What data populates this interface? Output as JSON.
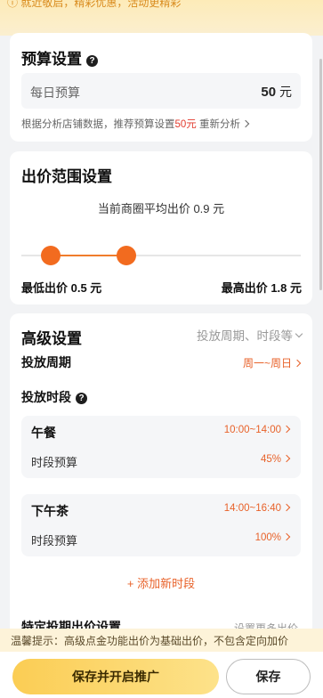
{
  "top_notice": "ⓘ 就近敬启，精彩优惠，活动更精彩",
  "budget": {
    "title": "预算设置",
    "daily_label": "每日预算",
    "daily_value": "50",
    "daily_unit": "元",
    "tip_prefix": "根据分析店铺数据，推荐预算设置",
    "tip_amount": "50元",
    "tip_link": "重新分析"
  },
  "bid": {
    "title": "出价范围设置",
    "avg_text": "当前商圈平均出价 0.9 元",
    "min_label": "最低出价 0.5 元",
    "max_label": "最高出价 1.8 元",
    "min_value": 0.5,
    "max_value": 1.8
  },
  "advanced": {
    "title": "高级设置",
    "hint": "投放周期、时段等",
    "period_label": "投放周期",
    "period_value": "周一~周日",
    "slot_section_label": "投放时段",
    "slots": [
      {
        "name": "午餐",
        "time": "10:00~14:00",
        "budget_label": "时段预算",
        "budget_pct": "45%"
      },
      {
        "name": "下午茶",
        "time": "14:00~16:40",
        "budget_label": "时段预算",
        "budget_pct": "100%"
      }
    ],
    "add_slot": "+ 添加新时段",
    "cut_row_label": "特定投期出价设置",
    "cut_row_value": "设置更多出价"
  },
  "warm_tip": "温馨提示：高级点金功能出价为基础出价，不包含定向加价",
  "buttons": {
    "primary": "保存并开启推广",
    "save": "保存"
  },
  "colors": {
    "accent": "#e8622a",
    "knob": "#f26b1f",
    "primary_btn": "#fbcd54"
  }
}
